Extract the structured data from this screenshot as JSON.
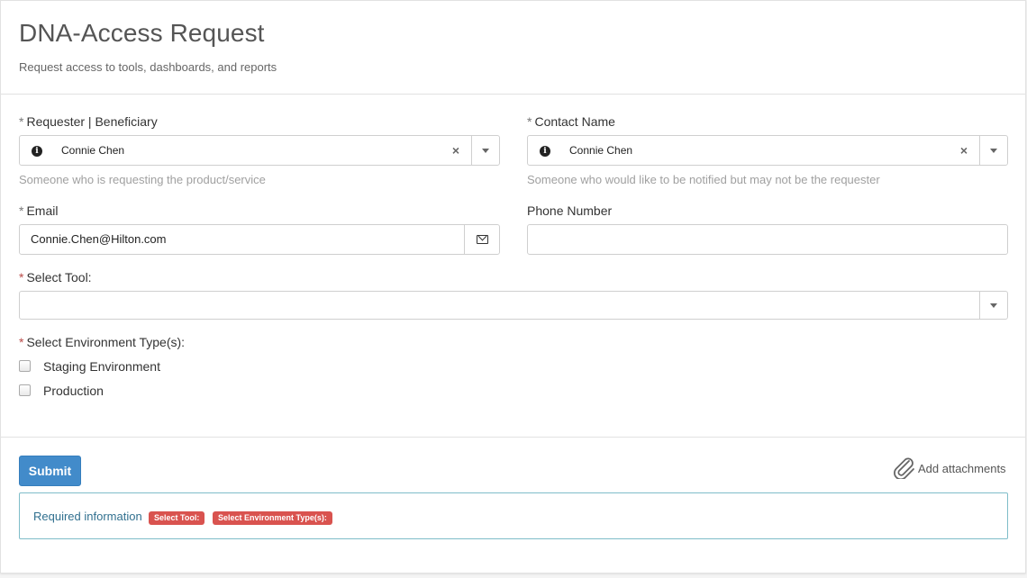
{
  "header": {
    "title": "DNA-Access Request",
    "subtitle": "Request access to tools, dashboards, and reports"
  },
  "requester": {
    "required_mark": "*",
    "label": "Requester | Beneficiary",
    "value": "Connie Chen",
    "help": "Someone who is requesting the product/service"
  },
  "contact": {
    "required_mark": "*",
    "label": "Contact Name",
    "value": "Connie Chen",
    "help": "Someone who would like to be notified but may not be the requester"
  },
  "email": {
    "required_mark": "*",
    "label": "Email",
    "value": "Connie.Chen@Hilton.com"
  },
  "phone": {
    "label": "Phone Number",
    "value": ""
  },
  "tool": {
    "required_mark": "*",
    "label": "Select Tool:",
    "value": ""
  },
  "environment": {
    "required_mark": "*",
    "label": "Select Environment Type(s):",
    "options": [
      {
        "label": "Staging Environment",
        "checked": false
      },
      {
        "label": "Production",
        "checked": false
      }
    ]
  },
  "footer": {
    "submit_label": "Submit",
    "attach_label": "Add attachments"
  },
  "alert": {
    "text": "Required information",
    "badges": [
      "Select Tool:",
      "Select Environment Type(s):"
    ]
  },
  "icons": {
    "info": "info-circle-icon",
    "clear": "close-icon",
    "dropdown": "chevron-down-icon",
    "email": "envelope-icon",
    "attach": "paperclip-icon"
  },
  "colors": {
    "primary": "#428bca",
    "required": "#b94a48",
    "badge": "#d9534f",
    "alert_text": "#31708f"
  }
}
